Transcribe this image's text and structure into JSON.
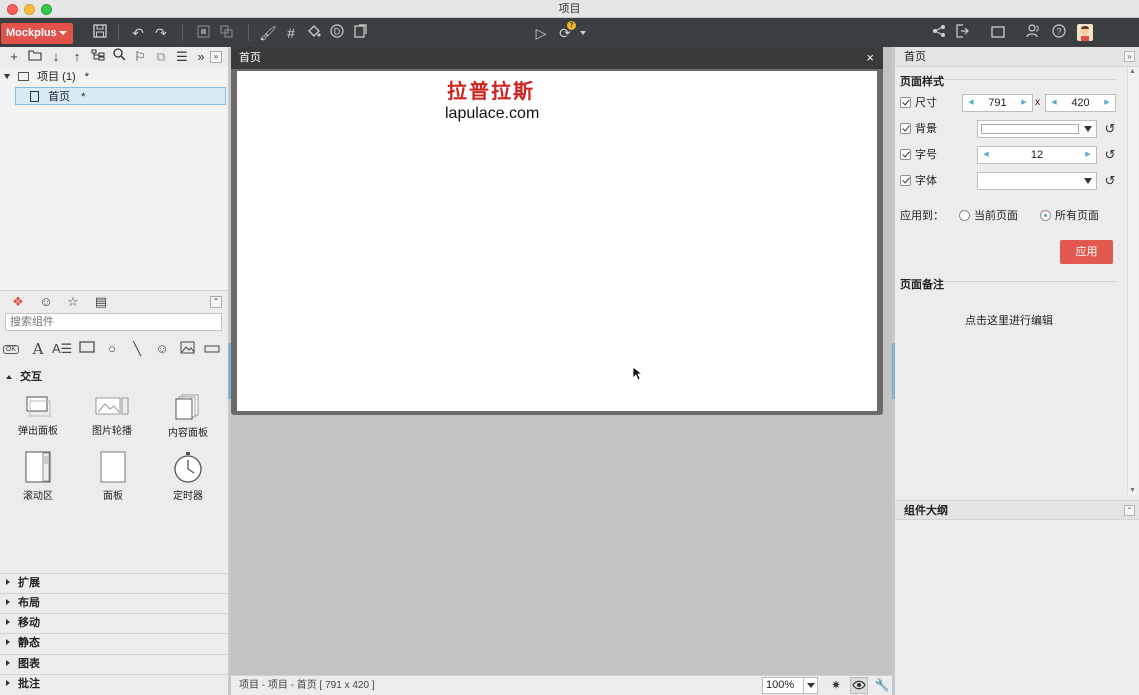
{
  "window": {
    "title": "项目"
  },
  "toolbar": {
    "brand": "Mockplus",
    "icons": [
      "save-icon",
      "undo-icon",
      "redo-icon",
      "group-icon",
      "ungroup-icon",
      "brush-icon",
      "grid-icon",
      "fill-icon",
      "d-icon",
      "export-icon",
      "play-icon",
      "sync-icon",
      "share-icon",
      "exit-icon",
      "frame-icon",
      "team-icon",
      "help-icon",
      "avatar"
    ],
    "sync_badge": "?"
  },
  "left": {
    "tree": {
      "project_label": "项目 (1)",
      "project_mark": "*",
      "page_label": "首页",
      "page_mark": "*"
    },
    "search_placeholder": "搜索组件",
    "category_open": "交互",
    "components": [
      {
        "label": "弹出面板",
        "icon": "popup-panel-icon"
      },
      {
        "label": "图片轮播",
        "icon": "image-carousel-icon"
      },
      {
        "label": "内容面板",
        "icon": "content-panel-icon"
      },
      {
        "label": "滚动区",
        "icon": "scroll-area-icon"
      },
      {
        "label": "面板",
        "icon": "panel-icon"
      },
      {
        "label": "定时器",
        "icon": "timer-icon"
      }
    ],
    "categories_closed": [
      "扩展",
      "布局",
      "移动",
      "静态",
      "图表",
      "批注"
    ]
  },
  "canvas": {
    "tab_title": "首页",
    "close": "×",
    "logo_cn": "拉普拉斯",
    "logo_en": "lapulace.com"
  },
  "status": {
    "path": "项目 - 项目 - 首页 [ 791 x 420 ]",
    "zoom": "100%"
  },
  "right": {
    "header": "首页",
    "page_style_title": "页面样式",
    "size_label": "尺寸",
    "width": "791",
    "times": "x",
    "height": "420",
    "bg_label": "背景",
    "fontsize_label": "字号",
    "fontsize": "12",
    "font_label": "字体",
    "apply_to_label": "应用到：",
    "apply_current": "当前页面",
    "apply_all": "所有页面",
    "apply_button": "应用",
    "notes_title": "页面备注",
    "notes_hint": "点击这里进行编辑",
    "outline_title": "组件大纲"
  },
  "colors": {
    "brand": "#e0524a",
    "toolbar": "#3c3f42",
    "logo_red": "#d0231f",
    "apply": "#e25a4f",
    "selection": "#d9ecf6"
  }
}
